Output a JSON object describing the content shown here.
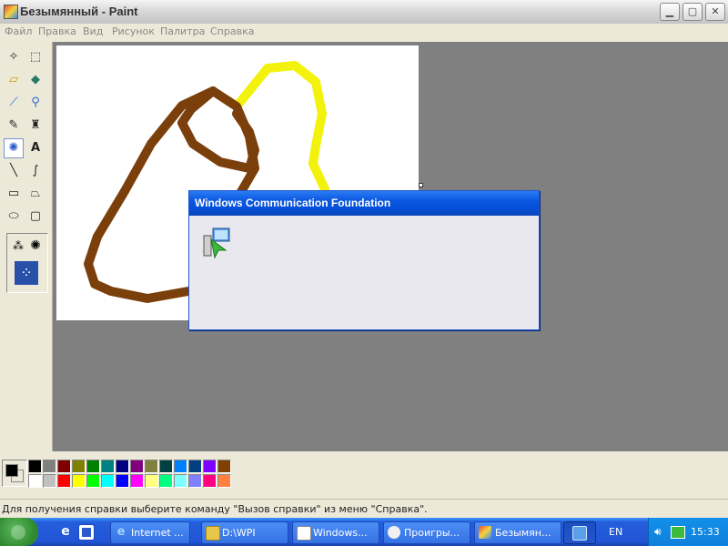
{
  "window": {
    "title": "Безымянный - Paint",
    "app_icon": "paint-icon",
    "controls": [
      "minimize-icon",
      "maximize-icon",
      "close-icon"
    ]
  },
  "menu": [
    "Файл",
    "Правка",
    "Вид",
    "Рисунок",
    "Палитра",
    "Справка"
  ],
  "tools": [
    {
      "name": "free-select",
      "glyph": "✧"
    },
    {
      "name": "rect-select",
      "glyph": "⬚"
    },
    {
      "name": "eraser",
      "glyph": "▱"
    },
    {
      "name": "fill",
      "glyph": "◆"
    },
    {
      "name": "color-picker",
      "glyph": "⟋"
    },
    {
      "name": "magnifier",
      "glyph": "⚲"
    },
    {
      "name": "pencil",
      "glyph": "✎"
    },
    {
      "name": "brush",
      "glyph": "♜"
    },
    {
      "name": "airbrush",
      "glyph": "✺"
    },
    {
      "name": "text",
      "glyph": "A"
    },
    {
      "name": "line",
      "glyph": "╲"
    },
    {
      "name": "curve",
      "glyph": "∫"
    },
    {
      "name": "rectangle",
      "glyph": "▭"
    },
    {
      "name": "polygon",
      "glyph": "⏢"
    },
    {
      "name": "ellipse",
      "glyph": "⬭"
    },
    {
      "name": "rounded-rectangle",
      "glyph": "▢"
    }
  ],
  "palette": {
    "foreground": "#000000",
    "background": "#ffffff",
    "row1": [
      "#000000",
      "#808080",
      "#800000",
      "#808000",
      "#008000",
      "#008080",
      "#000080",
      "#800080",
      "#808040",
      "#004040",
      "#0080ff",
      "#004080",
      "#8000ff",
      "#804000"
    ],
    "row2": [
      "#ffffff",
      "#c0c0c0",
      "#ff0000",
      "#ffff00",
      "#00ff00",
      "#00ffff",
      "#0000ff",
      "#ff00ff",
      "#ffff80",
      "#00ff80",
      "#80ffff",
      "#8080ff",
      "#ff0080",
      "#ff8040"
    ]
  },
  "status": {
    "text": "Для получения справки выберите команду \"Вызов справки\" из меню \"Справка\"."
  },
  "drawing": {
    "brown": "#7b3f0b",
    "yellow": "#f2f20c"
  },
  "dialog": {
    "title": "Windows Communication Foundation",
    "icon": "setup-computer-icon"
  },
  "taskbar": {
    "start": "start-icon",
    "quick_launch": [
      "internet-explorer-icon",
      "show-desktop-icon"
    ],
    "buttons": [
      {
        "label": "Internet ...",
        "icon": "ie-icon",
        "active": false
      },
      {
        "label": "D:\\WPI",
        "icon": "folder-icon",
        "active": false
      },
      {
        "label": "Windows...",
        "icon": "window-icon",
        "active": false
      },
      {
        "label": "Проигры...",
        "icon": "media-icon",
        "active": false
      },
      {
        "label": "Безымян...",
        "icon": "paint-icon",
        "active": false
      },
      {
        "label": "",
        "icon": "installer-icon",
        "active": true
      }
    ],
    "language": "EN",
    "clock": "15:33"
  }
}
